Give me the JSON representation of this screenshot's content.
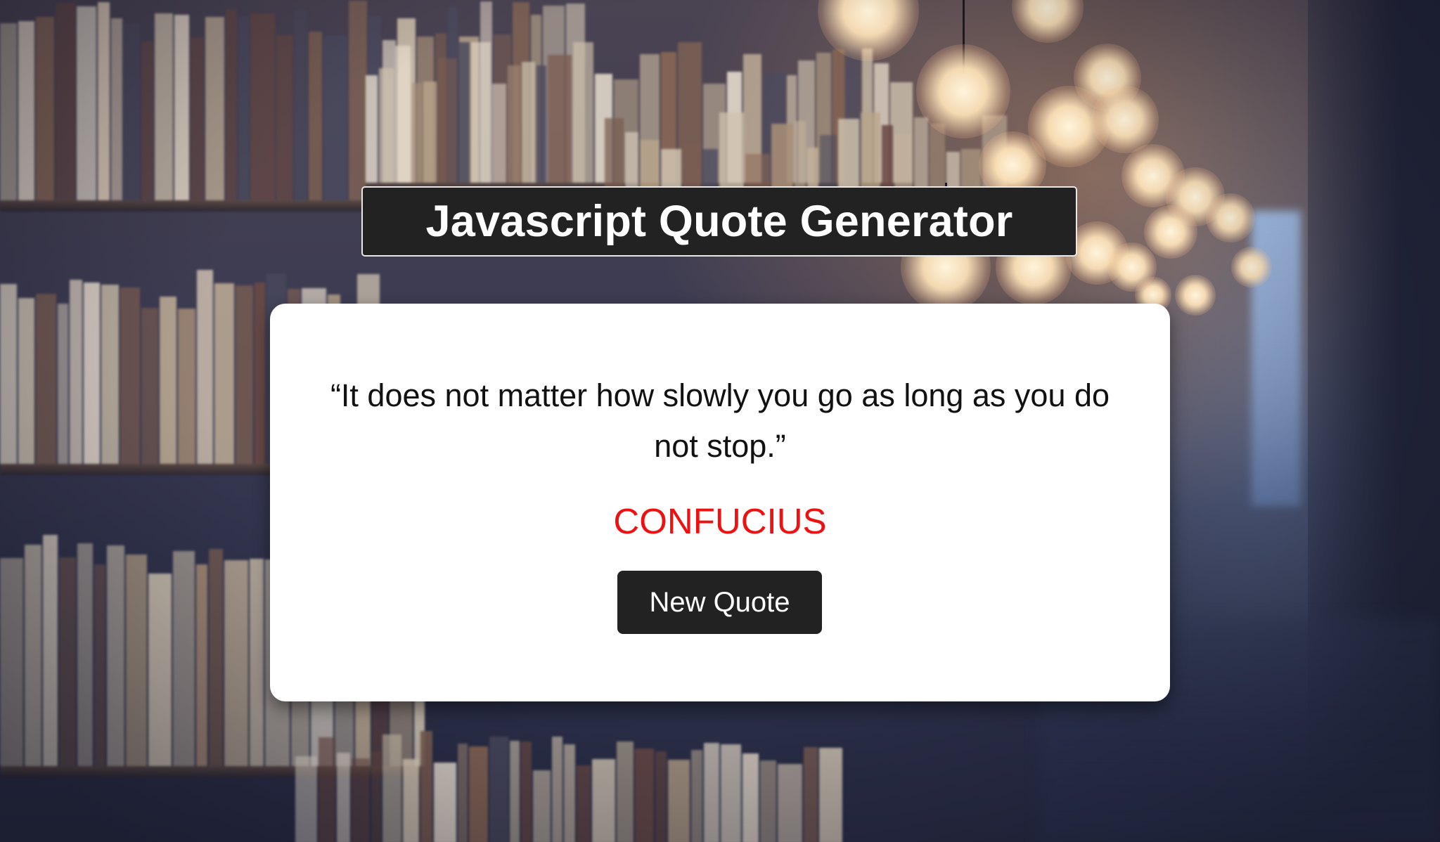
{
  "header": {
    "title": "Javascript Quote Generator"
  },
  "quote": {
    "text": "“It does not matter how slowly you go as long as you do not stop.”",
    "author": "CONFUCIUS"
  },
  "actions": {
    "new_quote_label": "New Quote"
  },
  "colors": {
    "title_background": "#222222",
    "card_background": "#ffffff",
    "author_color": "#ee1111",
    "button_background": "#222222"
  },
  "background": {
    "scene": "library-bookshelves-with-hanging-bulbs"
  }
}
